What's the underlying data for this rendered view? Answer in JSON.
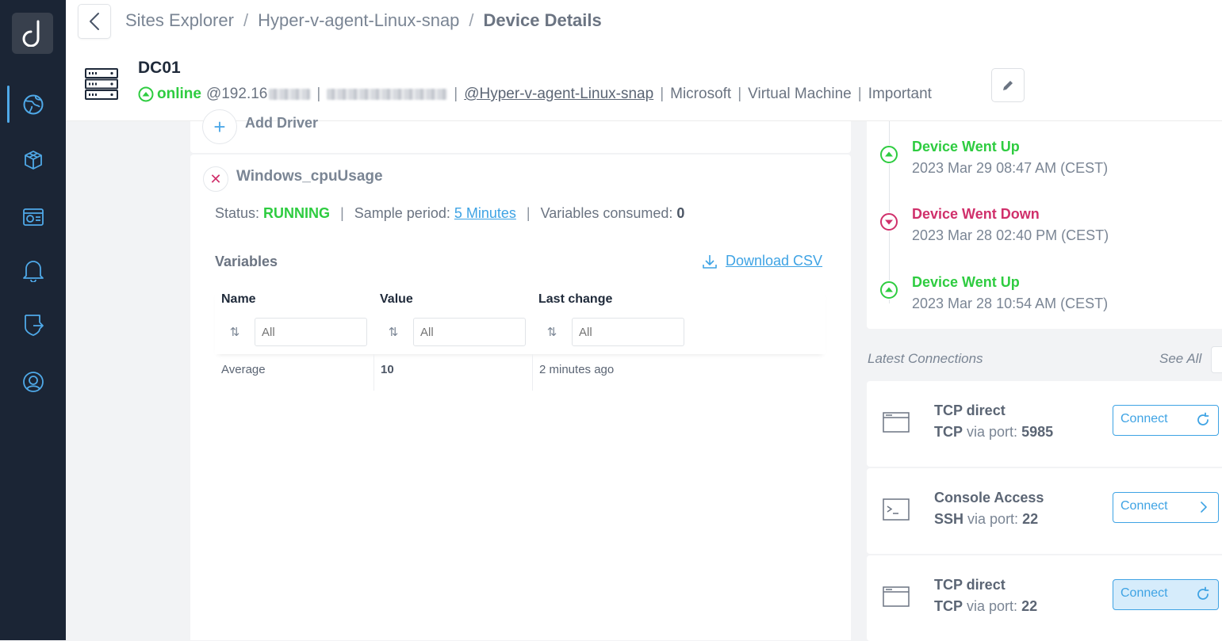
{
  "app": {
    "logo_letter": "d"
  },
  "sidebar": {
    "items": [
      {
        "name": "globe"
      },
      {
        "name": "cube"
      },
      {
        "name": "dashboard"
      },
      {
        "name": "bell"
      },
      {
        "name": "shield-export"
      },
      {
        "name": "support"
      }
    ],
    "accent": "#4fa9e8"
  },
  "breadcrumb": {
    "items": [
      "Sites Explorer",
      "Hyper-v-agent-Linux-snap",
      "Device Details"
    ],
    "separator": "/"
  },
  "device": {
    "name": "DC01",
    "status": "online",
    "ip": "@192.16",
    "site": "@Hyper-v-agent-Linux-snap",
    "vendor": "Microsoft",
    "type": "Virtual Machine",
    "priority": "Important"
  },
  "add_driver": {
    "label": "Add Driver"
  },
  "driver": {
    "name": "Windows_cpuUsage",
    "status_label": "Status:",
    "status_value": "RUNNING",
    "sample_label": "Sample period:",
    "sample_value": "5 Minutes",
    "vars_consumed_label": "Variables consumed:",
    "vars_consumed_value": "0",
    "variables_title": "Variables",
    "download_label": "Download CSV",
    "table": {
      "columns": [
        "Name",
        "Value",
        "Last change"
      ],
      "filter_placeholder": "All",
      "rows": [
        {
          "name": "Average",
          "value": "10",
          "last_change": "2 minutes ago"
        }
      ]
    }
  },
  "events": [
    {
      "title": "Device Went Up",
      "time": "2023 Mar 29 08:47 AM (CEST)",
      "kind": "up"
    },
    {
      "title": "Device Went Down",
      "time": "2023 Mar 28 02:40 PM (CEST)",
      "kind": "down"
    },
    {
      "title": "Device Went Up",
      "time": "2023 Mar 28 10:54 AM (CEST)",
      "kind": "up"
    }
  ],
  "connections": {
    "title": "Latest Connections",
    "see_all": "See All",
    "items": [
      {
        "title": "TCP direct",
        "protocol": "TCP",
        "via": "via port:",
        "port": "5985",
        "button": "Connect",
        "icon": "window-icon",
        "action_icon": "refresh-icon"
      },
      {
        "title": "Console Access",
        "protocol": "SSH",
        "via": "via port:",
        "port": "22",
        "button": "Connect",
        "icon": "terminal-icon",
        "action_icon": "chevron-right-icon"
      },
      {
        "title": "TCP direct",
        "protocol": "TCP",
        "via": "via port:",
        "port": "22",
        "button": "Connect",
        "icon": "window-icon",
        "action_icon": "refresh-icon"
      }
    ]
  },
  "colors": {
    "online": "#2ecc40",
    "down": "#d0306b",
    "link": "#3ea3e4",
    "sidebar_bg": "#1b2535"
  }
}
